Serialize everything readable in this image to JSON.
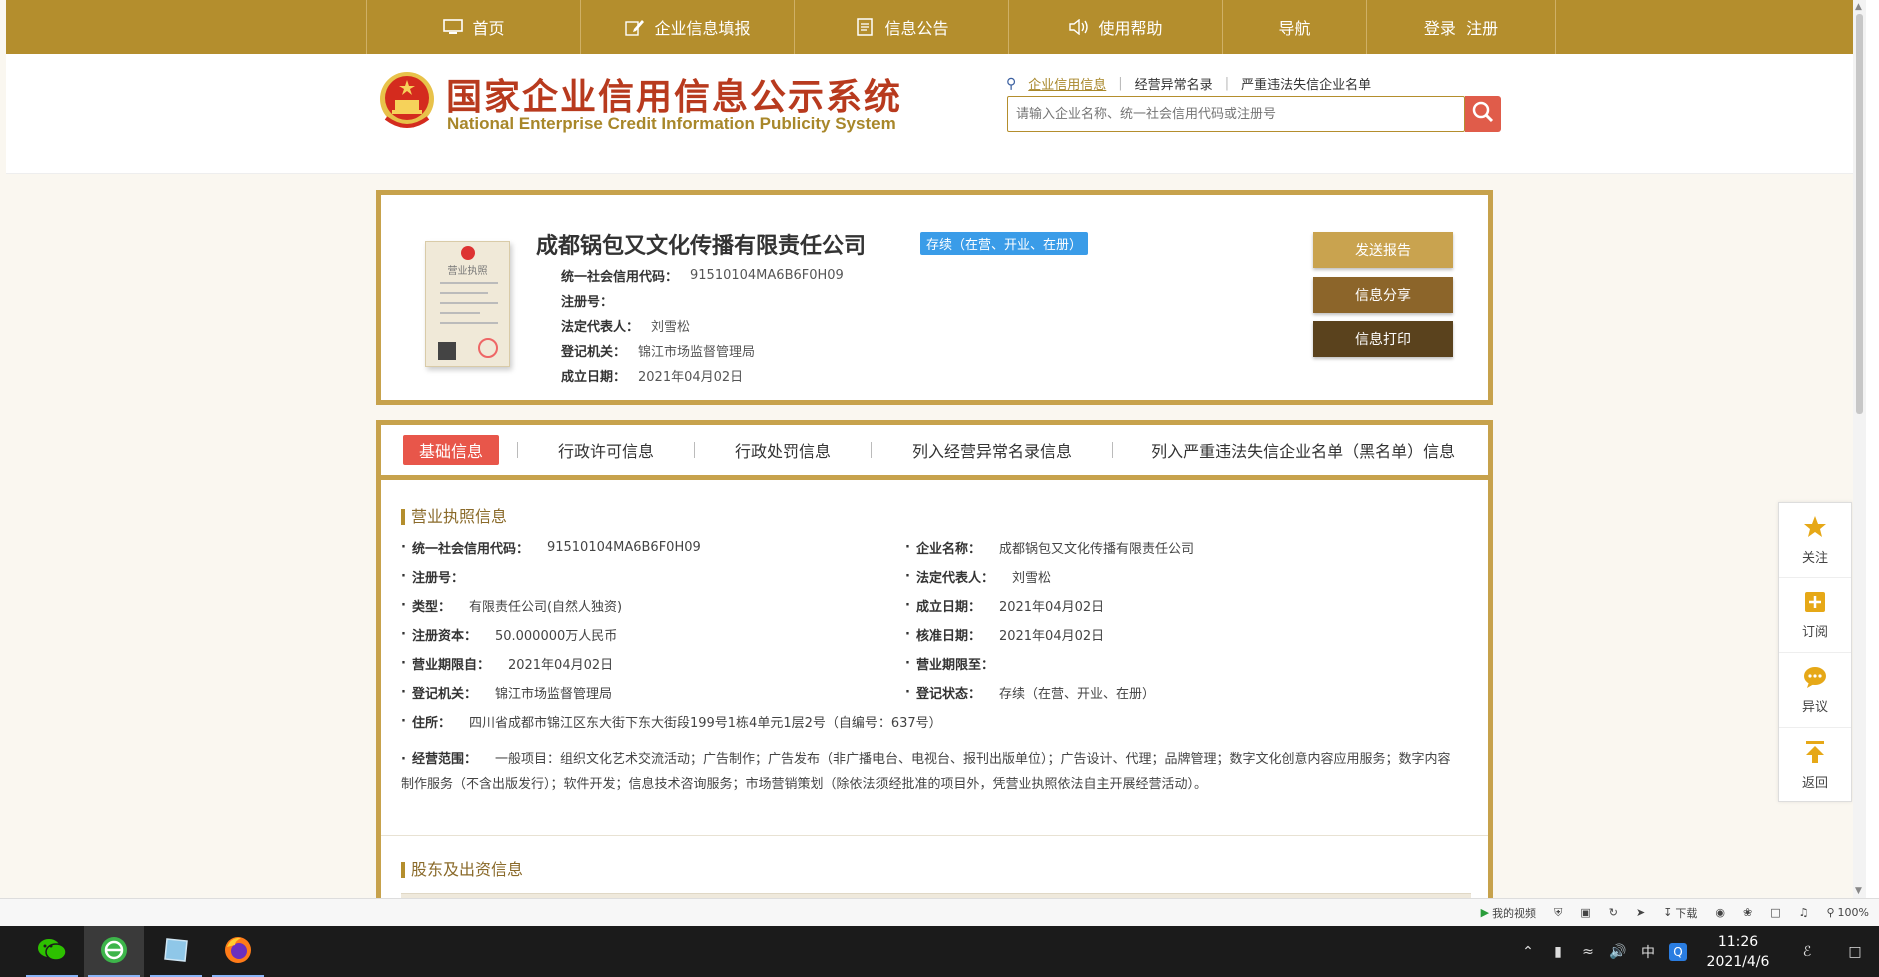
{
  "nav": {
    "items": [
      {
        "label": "首页",
        "icon": "monitor-icon"
      },
      {
        "label": "企业信息填报",
        "icon": "edit-icon"
      },
      {
        "label": "信息公告",
        "icon": "document-icon"
      },
      {
        "label": "使用帮助",
        "icon": "speaker-icon"
      },
      {
        "label": "导航",
        "icon": ""
      },
      {
        "label": "登录  注册",
        "icon": ""
      }
    ]
  },
  "header": {
    "logo_cn": "国家企业信用信息公示系统",
    "logo_en": "National Enterprise Credit Information Publicity System",
    "search_tabs": [
      "企业信用信息",
      "经营异常名录",
      "严重违法失信企业名单"
    ],
    "search_placeholder": "请输入企业名称、统一社会信用代码或注册号"
  },
  "company": {
    "name": "成都锅包又文化传播有限责任公司",
    "status": "存续（在营、开业、在册）",
    "license_title": "营业执照",
    "fields": [
      {
        "label": "统一社会信用代码：",
        "value": "91510104MA6B6F0H09"
      },
      {
        "label": "注册号：",
        "value": ""
      },
      {
        "label": "法定代表人：",
        "value": "刘雪松"
      },
      {
        "label": "登记机关：",
        "value": "锦江市场监督管理局"
      },
      {
        "label": "成立日期：",
        "value": "2021年04月02日"
      }
    ],
    "buttons": {
      "send": "发送报告",
      "share": "信息分享",
      "print": "信息打印"
    }
  },
  "detail": {
    "tabs": [
      "基础信息",
      "行政许可信息",
      "行政处罚信息",
      "列入经营异常名录信息",
      "列入严重违法失信企业名单（黑名单）信息"
    ],
    "section_license": "营业执照信息",
    "left_rows": [
      {
        "label": "统一社会信用代码：",
        "value": "91510104MA6B6F0H09"
      },
      {
        "label": "注册号：",
        "value": ""
      },
      {
        "label": "类型：",
        "value": "有限责任公司(自然人独资)"
      },
      {
        "label": "注册资本：",
        "value": "50.000000万人民币"
      },
      {
        "label": "营业期限自：",
        "value": "2021年04月02日"
      },
      {
        "label": "登记机关：",
        "value": "锦江市场监督管理局"
      }
    ],
    "right_rows": [
      {
        "label": "企业名称：",
        "value": "成都锅包又文化传播有限责任公司"
      },
      {
        "label": "法定代表人：",
        "value": "刘雪松"
      },
      {
        "label": "成立日期：",
        "value": "2021年04月02日"
      },
      {
        "label": "核准日期：",
        "value": "2021年04月02日"
      },
      {
        "label": "营业期限至：",
        "value": ""
      },
      {
        "label": "登记状态：",
        "value": "存续（在营、开业、在册）"
      }
    ],
    "address_label": "住所：",
    "address": "四川省成都市锦江区东大街下东大街段199号1栋4单元1层2号（自编号：637号）",
    "scope_label": "经营范围：",
    "scope": "一般项目：组织文化艺术交流活动；广告制作；广告发布（非广播电台、电视台、报刊出版单位）；广告设计、代理；品牌管理；数字文化创意内容应用服务；数字内容制作服务（不含出版发行）；软件开发；信息技术咨询服务；市场营销策划（除依法须经批准的项目外，凭营业执照依法自主开展经营活动）。",
    "section_shareholder": "股东及出资信息"
  },
  "float": {
    "follow": "关注",
    "subscribe": "订阅",
    "objection": "异议",
    "back": "返回"
  },
  "statusbar": {
    "video": "我的视频",
    "download": "下载",
    "zoom": "100%"
  },
  "taskbar": {
    "time": "11:26",
    "date": "2021/4/6",
    "ime": "中"
  },
  "colors": {
    "gold": "#b48e2d",
    "card_border": "#c7a24c",
    "red": "#e8564a",
    "blue_badge": "#3a9ce8"
  }
}
